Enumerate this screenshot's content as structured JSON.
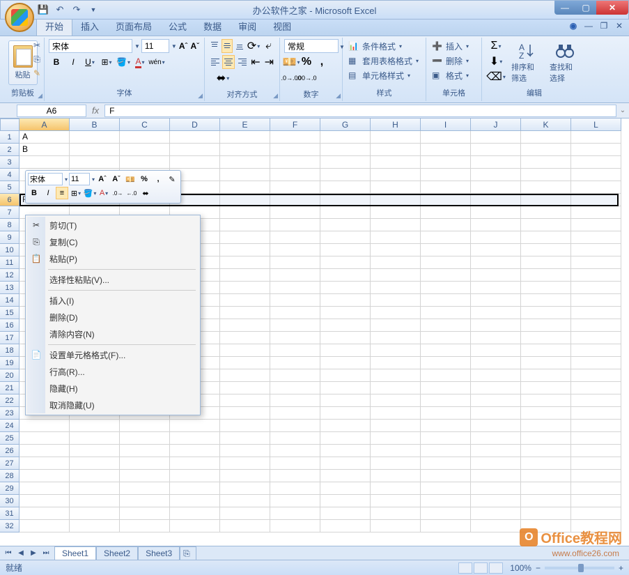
{
  "window": {
    "title": "办公软件之家 - Microsoft Excel"
  },
  "ribbon_tabs": [
    "开始",
    "插入",
    "页面布局",
    "公式",
    "数据",
    "审阅",
    "视图"
  ],
  "active_tab_index": 0,
  "clipboard": {
    "paste_label": "粘贴",
    "group_label": "剪贴板"
  },
  "font": {
    "name": "宋体",
    "size": "11",
    "group_label": "字体"
  },
  "alignment": {
    "group_label": "对齐方式"
  },
  "number": {
    "format": "常规",
    "group_label": "数字"
  },
  "styles": {
    "conditional": "条件格式",
    "table": "套用表格格式",
    "cell": "单元格样式",
    "group_label": "样式"
  },
  "cells_group": {
    "insert": "插入",
    "delete": "删除",
    "format": "格式",
    "group_label": "单元格"
  },
  "editing": {
    "sort": "排序和筛选",
    "find": "查找和选择",
    "group_label": "编辑"
  },
  "formula_bar": {
    "name_box": "A6",
    "fx": "fx",
    "value": "F"
  },
  "columns": [
    "A",
    "B",
    "C",
    "D",
    "E",
    "F",
    "G",
    "H",
    "I",
    "J",
    "K",
    "L"
  ],
  "rows": [
    "1",
    "2",
    "3",
    "4",
    "5",
    "6",
    "7",
    "8",
    "9",
    "10",
    "11",
    "12",
    "13",
    "14",
    "15",
    "16",
    "17",
    "18",
    "19",
    "20",
    "21",
    "22",
    "23",
    "24",
    "25",
    "26",
    "27",
    "28",
    "29",
    "30",
    "31",
    "32"
  ],
  "cell_data": {
    "A1": "A",
    "A2": "B",
    "A6": "F"
  },
  "mini_toolbar": {
    "font": "宋体",
    "size": "11"
  },
  "context_menu": {
    "cut": "剪切(T)",
    "copy": "复制(C)",
    "paste": "粘贴(P)",
    "paste_special": "选择性粘贴(V)...",
    "insert": "插入(I)",
    "delete": "删除(D)",
    "clear": "清除内容(N)",
    "format_cells": "设置单元格格式(F)...",
    "row_height": "行高(R)...",
    "hide": "隐藏(H)",
    "unhide": "取消隐藏(U)"
  },
  "sheets": [
    "Sheet1",
    "Sheet2",
    "Sheet3"
  ],
  "status": {
    "ready": "就绪",
    "zoom": "100%"
  },
  "watermark": {
    "main": "Office教程网",
    "sub": "www.office26.com"
  }
}
